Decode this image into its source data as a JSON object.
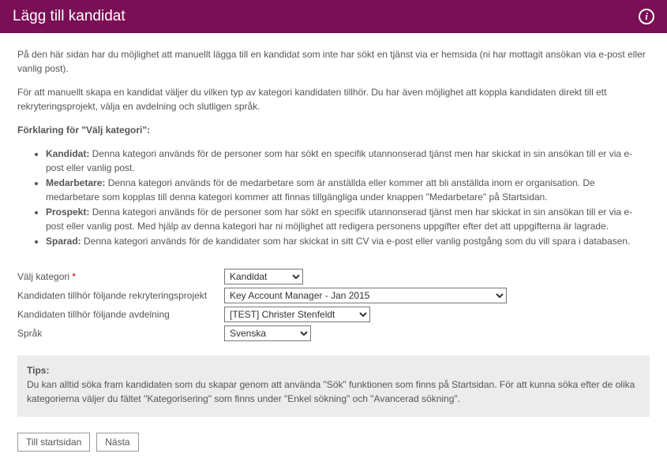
{
  "header": {
    "title": "Lägg till kandidat",
    "info_icon_glyph": "i"
  },
  "intro": {
    "p1": "På den här sidan har du möjlighet att manuellt lägga till en kandidat som inte har sökt en tjänst via er hemsida (ni har mottagit ansökan via e-post eller vanlig post).",
    "p2": "För att manuellt skapa en kandidat väljer du vilken typ av kategori kandidaten tillhör. Du har även möjlighet att koppla kandidaten direkt till ett rekryteringsprojekt, välja en avdelning och slutligen språk.",
    "explain_title": "Förklaring för \"Välj kategori\":"
  },
  "bullets": [
    {
      "term": "Kandidat:",
      "text": " Denna kategori används för de personer som har sökt en specifik utannonserad tjänst men har skickat in sin ansökan till er via e-post eller vanlig post."
    },
    {
      "term": "Medarbetare:",
      "text": " Denna kategori används för de medarbetare som är anställda eller kommer att bli anställda inom er organisation. De medarbetare som kopplas till denna kategori kommer att finnas tillgängliga under knappen \"Medarbetare\" på Startsidan."
    },
    {
      "term": "Prospekt:",
      "text": " Denna kategori används för de personer som har sökt en specifik utannonserad tjänst men har skickat in sin ansökan till er via e-post eller vanlig post. Med hjälp av denna kategori har ni möjlighet att redigera personens uppgifter efter det att uppgifterna är lagrade."
    },
    {
      "term": "Sparad:",
      "text": " Denna kategori används för de kandidater som har skickat in sitt CV via e-post eller vanlig postgång som du vill spara i databasen."
    }
  ],
  "form": {
    "category_label": "Välj kategori",
    "required_mark": "*",
    "project_label": "Kandidaten tillhör följande rekryteringsprojekt",
    "dept_label": "Kandidaten tillhör följande avdelning",
    "lang_label": "Språk",
    "category_value": "Kandidat",
    "project_value": "Key Account Manager - Jan 2015",
    "dept_value": "[TEST] Christer Stenfeldt",
    "lang_value": "Svenska"
  },
  "tips": {
    "title": "Tips:",
    "body": "Du kan alltid söka fram kandidaten som du skapar genom att använda \"Sök\" funktionen som finns på Startsidan. För att kunna söka efter de olika kategorierna väljer du fältet \"Kategorisering\" som finns under \"Enkel sökning\" och \"Avancerad sökning\"."
  },
  "buttons": {
    "home": "Till startsidan",
    "next": "Nästa"
  }
}
